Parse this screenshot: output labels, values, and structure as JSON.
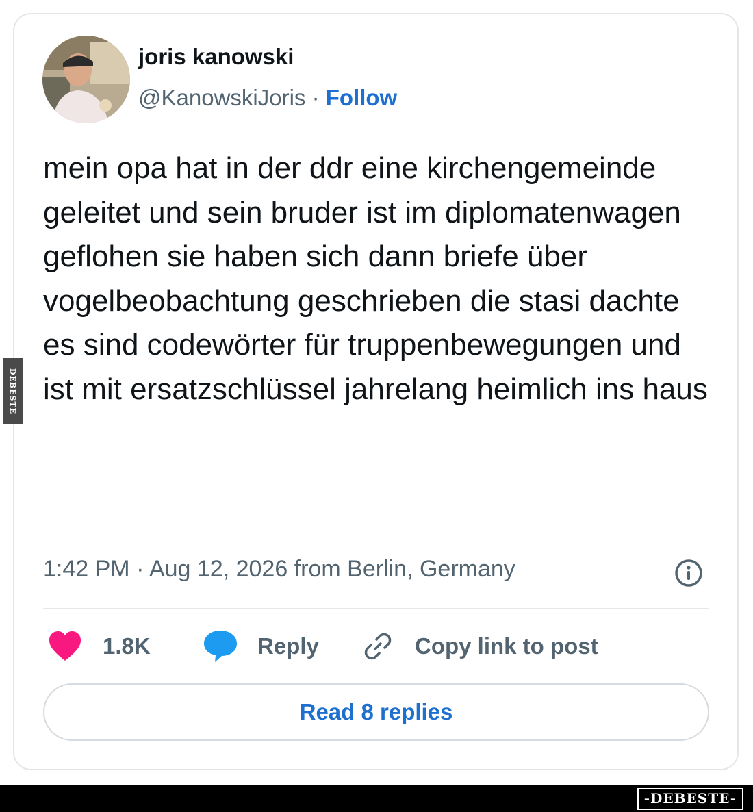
{
  "tweet": {
    "author": {
      "name": "joris kanowski",
      "handle": "@KanowskiJoris",
      "separator": "·",
      "follow_label": "Follow"
    },
    "text": "mein opa hat in der ddr eine kirchengemeinde geleitet und sein bruder ist im diplomatenwagen geflohen sie haben sich dann briefe über vogelbeobachtung geschrieben die stasi dachte es sind codewörter für truppenbewegungen und ist mit ersatzschlüssel jahrelang heimlich ins haus",
    "timestamp": "1:42 PM · Aug 12, 2026 from Berlin, Germany",
    "info_icon": "info-circle-icon",
    "actions": {
      "like_count": "1.8K",
      "like_icon": "heart-icon",
      "reply_label": "Reply",
      "reply_icon": "speech-bubble-icon",
      "copy_label": "Copy link to post",
      "copy_icon": "link-icon"
    },
    "read_replies_label": "Read 8 replies"
  },
  "watermark": {
    "side": "DEBESTE",
    "bottom": "-DEBESTE-"
  },
  "colors": {
    "text": "#0f1419",
    "secondary": "#536471",
    "link": "#1d6fd0",
    "like": "#f91880",
    "reply": "#1d9bf0",
    "border": "#e3e6e9"
  }
}
